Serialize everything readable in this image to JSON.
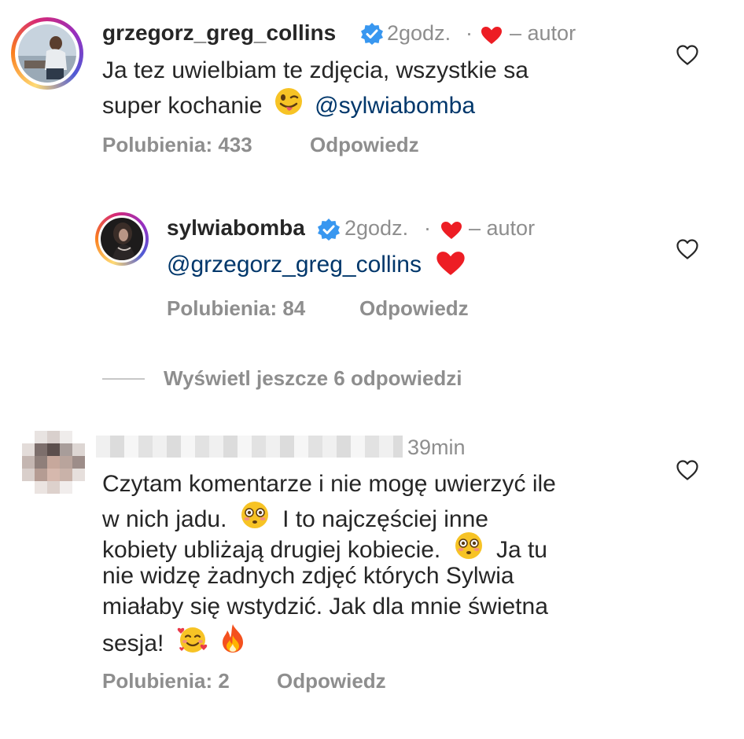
{
  "comments": [
    {
      "username": "grzegorz_greg_collins",
      "time": "2godz.",
      "separator": "·",
      "author_tag": "– autor",
      "text_line1": "Ja tez uwielbiam te zdjęcia, wszystkie sa",
      "text_line2_prefix": "super kochanie",
      "text_mention": "@sylwiabomba",
      "likes": "Polubienia: 433",
      "reply": "Odpowiedz"
    },
    {
      "username": "sylwiabomba",
      "time": "2godz.",
      "separator": "·",
      "author_tag": "– autor",
      "text_mention": "@grzegorz_greg_collins",
      "likes": "Polubienia: 84",
      "reply": "Odpowiedz"
    },
    {
      "time": "39min",
      "text_lines": [
        "Czytam komentarze i nie mogę uwierzyć ile",
        "w nich jadu.",
        "I to najczęściej inne",
        "kobiety ubliżają drugiej kobiecie.",
        "Ja tu",
        "nie widzę żadnych zdjęć których Sylwia",
        "miałaby się wstydzić. Jak dla mnie świetna",
        "sesja!"
      ],
      "likes": "Polubienia: 2",
      "reply": "Odpowiedz"
    }
  ],
  "view_more_replies": "Wyświetl jeszcze 6 odpowiedzi",
  "icons": {
    "verified": "verified-badge-icon",
    "heart": "heart-outline-icon",
    "red_heart": "red-heart-emoji"
  },
  "colors": {
    "text": "#262626",
    "muted": "#8e8e8e",
    "mention": "#00376b",
    "verified": "#3897f0",
    "heart_red": "#ed1d24"
  }
}
